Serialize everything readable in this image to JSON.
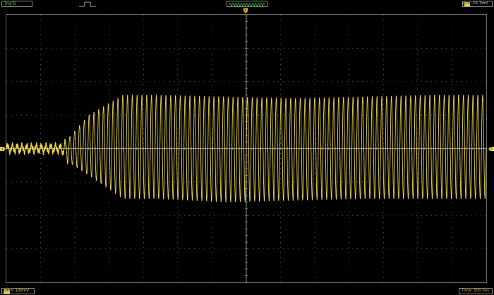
{
  "topbar": {
    "trigger_status": "Trig'D",
    "channel_tag": "CH1",
    "trigger_level": "-15.7mV"
  },
  "bottombar": {
    "channel_tag": "CH1",
    "volts_per_div": "100mV",
    "timebase_label": "Time",
    "timebase_value": "500.0us"
  },
  "markers": {
    "channel_marker": "1",
    "trigger_marker": "T"
  },
  "colors": {
    "trace": "#e8d24a",
    "grid": "#5a5a5a",
    "trigger_text": "#33dd33",
    "time_text": "#e0a020"
  },
  "chart_data": {
    "type": "line",
    "title": "",
    "xlabel": "",
    "ylabel": "",
    "grid": true,
    "grid_divisions": {
      "horizontal": 14,
      "vertical": 8
    },
    "units": {
      "x": "s",
      "y": "V"
    },
    "x_div": 0.0005,
    "y_div": 0.1,
    "xlim": [
      -0.0035,
      0.0035
    ],
    "ylim": [
      -0.4,
      0.4
    ],
    "series": [
      {
        "cycles": 100,
        "envelope_x": [
          -0.0035,
          -0.0027,
          -0.0026,
          -0.0023,
          -0.0018,
          -0.0013,
          -0.0003,
          0.0007,
          0.0017,
          0.0027,
          0.0035
        ],
        "envelope_y": [
          0.01,
          0.01,
          0.03,
          0.1,
          0.16,
          0.16,
          0.155,
          0.15,
          0.155,
          0.16,
          0.16
        ],
        "envelope_y_neg": [
          -0.01,
          -0.01,
          -0.04,
          -0.08,
          -0.15,
          -0.15,
          -0.16,
          -0.155,
          -0.15,
          -0.15,
          -0.15
        ]
      }
    ]
  }
}
